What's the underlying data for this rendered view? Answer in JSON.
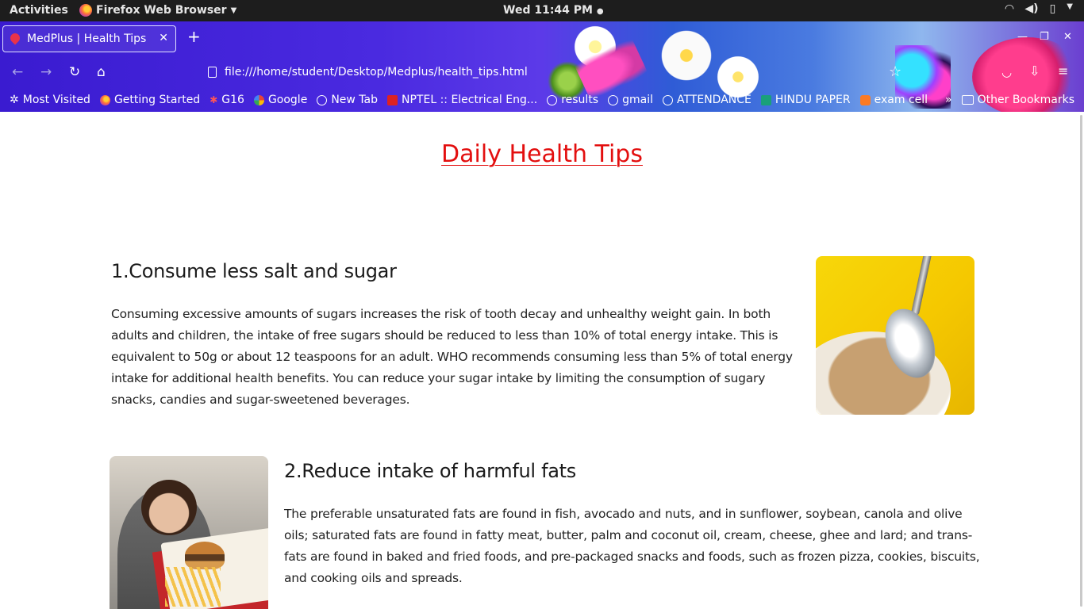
{
  "system_bar": {
    "activities": "Activities",
    "app_name": "Firefox Web Browser",
    "clock": "Wed 11:44 PM"
  },
  "browser": {
    "tab_title": "MedPlus | Health Tips",
    "url": "file:///home/student/Desktop/Medplus/health_tips.html",
    "bookmarks": [
      {
        "label": "Most Visited",
        "icon": "gear-icon"
      },
      {
        "label": "Getting Started",
        "icon": "firefox-icon"
      },
      {
        "label": "G16",
        "icon": "bug-icon"
      },
      {
        "label": "Google",
        "icon": "google-icon"
      },
      {
        "label": "New Tab",
        "icon": "globe-icon"
      },
      {
        "label": "NPTEL :: Electrical Eng...",
        "icon": "nptel-icon"
      },
      {
        "label": "results",
        "icon": "globe-icon"
      },
      {
        "label": "gmail",
        "icon": "globe-icon"
      },
      {
        "label": "ATTENDANCE",
        "icon": "globe-icon"
      },
      {
        "label": "HINDU PAPER",
        "icon": "graduation-cap-icon"
      },
      {
        "label": "exam cell",
        "icon": "xampp-icon"
      }
    ],
    "other_bookmarks": "Other Bookmarks"
  },
  "page": {
    "heading": "Daily Health Tips",
    "tips": [
      {
        "title": "1.Consume less salt and sugar",
        "body": "Consuming excessive amounts of sugars increases the risk of tooth decay and unhealthy weight gain. In both adults and children, the intake of free sugars should be reduced to less than 10% of total energy intake. This is equivalent to 50g or about 12 teaspoons for an adult. WHO recommends consuming less than 5% of total energy intake for additional health benefits. You can reduce your sugar intake by limiting the consumption of sugary snacks, candies and sugar-sweetened beverages."
      },
      {
        "title": "2.Reduce intake of harmful fats",
        "body": "The preferable unsaturated fats are found in fish, avocado and nuts, and in sunflower, soybean, canola and olive oils; saturated fats are found in fatty meat, butter, palm and coconut oil, cream, cheese, ghee and lard; and trans-fats are found in baked and fried foods, and pre-packaged snacks and foods, such as frozen pizza, cookies, biscuits, and cooking oils and spreads."
      }
    ]
  }
}
